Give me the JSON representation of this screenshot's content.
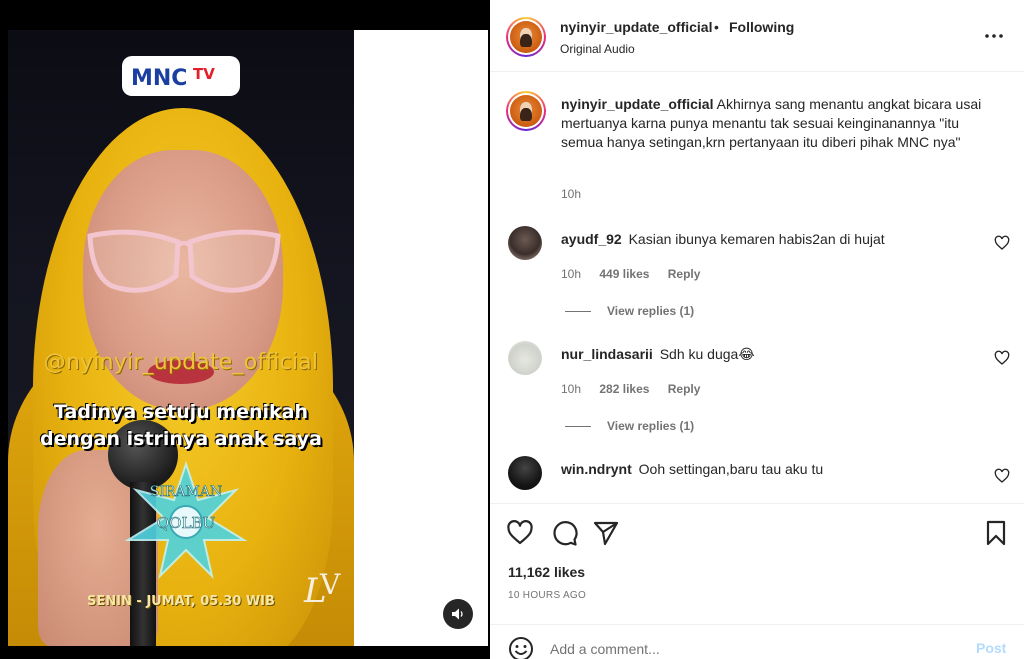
{
  "video": {
    "channel_logo_text": "MNCTV",
    "overlay_handle": "@nyinyir_update_official",
    "overlay_caption_line1": "Tadinya setuju menikah",
    "overlay_caption_line2": "dengan istrinya anak saya",
    "show_name": "SIRAMAN QOLBU",
    "schedule": "SENIN - JUMAT, 05.30 WIB",
    "audio_icon": "speaker-icon"
  },
  "header": {
    "username": "nyinyir_update_official",
    "separator": "•",
    "follow_status": "Following",
    "audio_label": "Original Audio",
    "more_icon": "more-dots-icon"
  },
  "caption": {
    "username": "nyinyir_update_official",
    "text": "Akhirnya sang menantu angkat bicara usai mertuanya karna punya menantu tak sesuai keinginanannya \"itu semua hanya setingan,krn pertanyaan itu diberi pihak MNC nya\"",
    "time": "10h"
  },
  "comments": [
    {
      "username": "ayudf_92",
      "text": "Kasian ibunya kemaren habis2an di hujat",
      "time": "10h",
      "likes": "449 likes",
      "reply": "Reply",
      "view_replies": "View replies (1)"
    },
    {
      "username": "nur_lindasarii",
      "text": "Sdh ku duga😂",
      "time": "10h",
      "likes": "282 likes",
      "reply": "Reply",
      "view_replies": "View replies (1)"
    },
    {
      "username": "win.ndrynt",
      "text": "Ooh settingan,baru tau aku tu"
    }
  ],
  "actions": {
    "likes": "11,162 likes",
    "age": "10 HOURS AGO"
  },
  "comment_box": {
    "placeholder": "Add a comment...",
    "post_label": "Post"
  },
  "colors": {
    "hijab": "#f0c020",
    "link_disabled": "#b3dbff",
    "secondary_text": "#737373"
  }
}
